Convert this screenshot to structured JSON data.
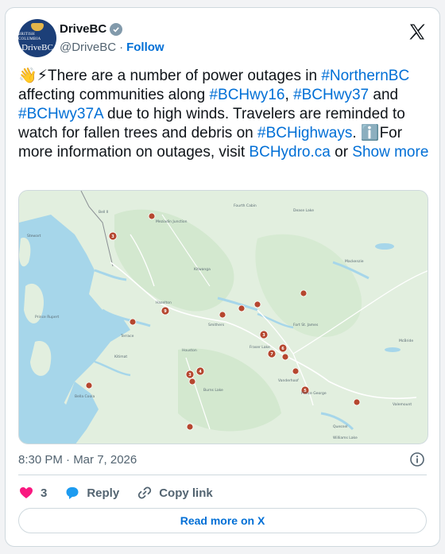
{
  "account": {
    "name": "DriveBC",
    "handle": "@DriveBC",
    "separator": "·",
    "follow_label": "Follow",
    "avatar_small_text": "BRITISH COLUMBIA",
    "avatar_brand_text": "DriveBC"
  },
  "tweet": {
    "emoji": "👋⚡",
    "text_a": "There are a number of power outages in ",
    "tag_northernbc": "#NorthernBC",
    "text_b": " affecting communities along ",
    "tag_hwy16": "#BCHwy16",
    "text_c": ",",
    "tag_hwy37": "#BCHwy37",
    "text_d": " and ",
    "tag_hwy37a": "#BCHwy37A",
    "text_e": " due to high winds. Travelers are reminded to watch for fallen trees and debris on ",
    "tag_bchighways": "#BCHighways",
    "text_f": ". ",
    "info_emoji": "ℹ️",
    "text_g": "For more information on outages, visit ",
    "link_bchydro": "BCHydro.ca",
    "text_h": " or ",
    "show_more": "Show more"
  },
  "timestamp": "8:30 PM · Mar 7, 2026",
  "actions": {
    "like_count": "3",
    "reply_label": "Reply",
    "copy_link_label": "Copy link"
  },
  "read_more_label": "Read more on X",
  "map": {
    "towns": [
      "Bell II",
      "Fourth Cabin",
      "Dease Lake",
      "Meziadin Junction",
      "Stewart",
      "Kitwanga",
      "Hazelton",
      "Smithers",
      "Terrace",
      "Kitimat",
      "Prince Rupert",
      "Houston",
      "Burns Lake",
      "Fraser Lake",
      "Vanderhoof",
      "Fort St. James",
      "Prince George",
      "Mackenzie",
      "McBride",
      "Valemount",
      "Bella Coola",
      "Quesnel",
      "Williams Lake"
    ],
    "outage_numbers": [
      "3",
      "9",
      "3",
      "7",
      "6",
      "4",
      "3",
      "5"
    ],
    "colors": {
      "land": "#dfeedd",
      "water": "#9fd3e8",
      "pin": "#b5472f",
      "road": "#ffffff"
    }
  }
}
